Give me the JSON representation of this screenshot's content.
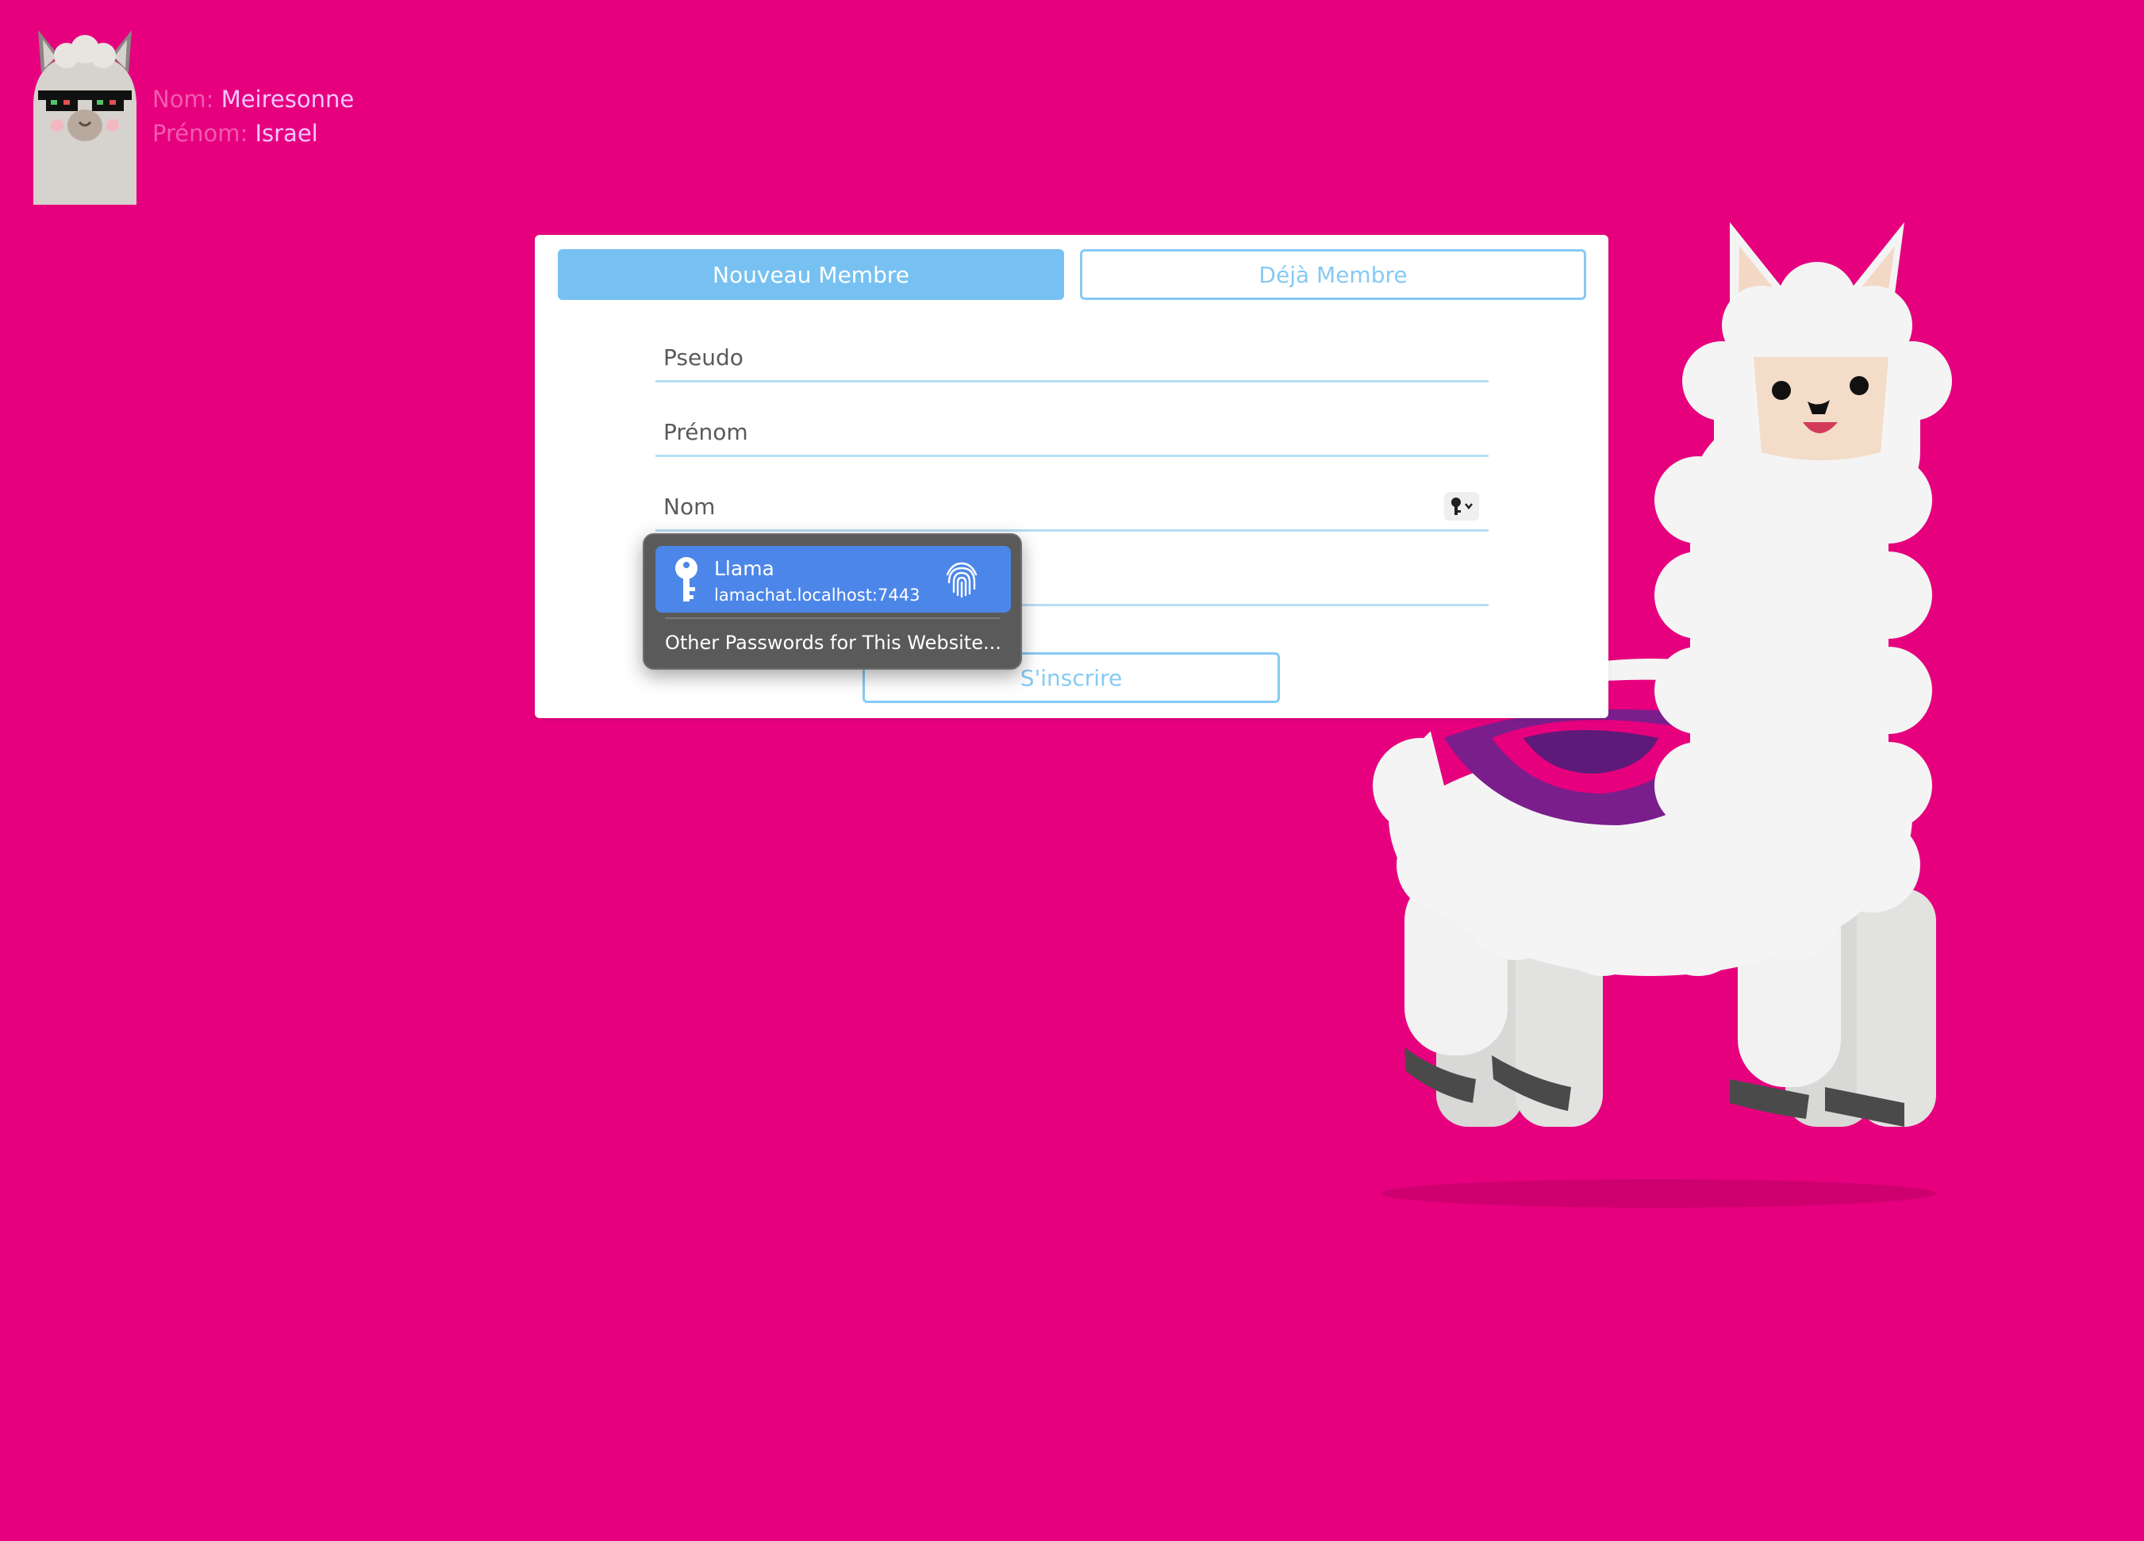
{
  "user": {
    "nom_label": "Nom:",
    "nom_value": "Meiresonne",
    "prenom_label": "Prénom:",
    "prenom_value": "Israel"
  },
  "tabs": {
    "new_member": "Nouveau Membre",
    "existing_member": "Déjà Membre"
  },
  "form": {
    "pseudo_placeholder": "Pseudo",
    "prenom_placeholder": "Prénom",
    "nom_placeholder": "Nom",
    "password_placeholder": "",
    "submit_label": "S'inscrire"
  },
  "autofill": {
    "item_title": "Llama",
    "item_subtitle": "lamachat.localhost:7443",
    "other_label": "Other Passwords for This Website..."
  },
  "colors": {
    "background": "#E6007E",
    "accent": "#77C1F2",
    "autofill_highlight": "#4C86E8"
  }
}
